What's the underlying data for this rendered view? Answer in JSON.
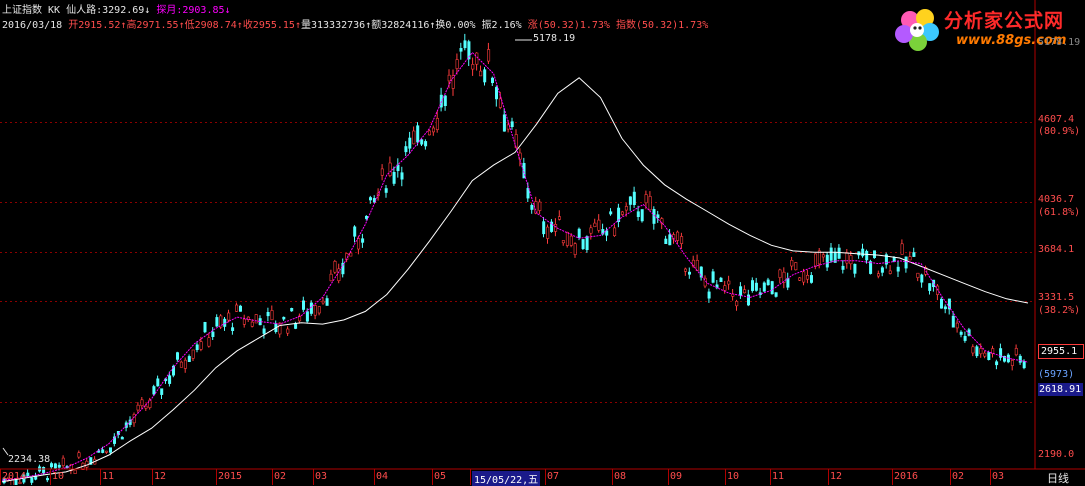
{
  "header": {
    "index_name": "上证指数",
    "indicator": "KK",
    "line1_label": "仙人路:3292.69",
    "line1_arrow": "↓",
    "line2_label": "探月:2903.85",
    "line2_arrow": "↓",
    "date": "2016/03/18",
    "open": "开2915.52",
    "high": "高2971.55",
    "low": "低2908.74",
    "close": "收2955.15",
    "volume": "量313332736",
    "amount": "额32824116",
    "turnover": "换0.00%",
    "amplitude": "振2.16%",
    "change": "涨(50.32)1.73%",
    "points": "指数(50.32)1.73%"
  },
  "logo": {
    "title": "分析家公式网",
    "url": "www.88gs.com"
  },
  "right_axis": {
    "top_partial": "5178.19",
    "l1": "4607.4",
    "l1p": "(80.9%)",
    "l2": "4036.7",
    "l2p": "(61.8%)",
    "l3": "3684.1",
    "l4": "3331.5",
    "l4p": "(38.2%)",
    "current": "2955.1",
    "count": "(5973)",
    "low_mark": "2618.91",
    "l5": "2190.0"
  },
  "annotations": {
    "high": "5178.19",
    "low": "2234.38"
  },
  "x_axis": {
    "ticks": [
      "2014",
      "10",
      "11",
      "12",
      "2015",
      "02",
      "03",
      "04",
      "05",
      "15/05/22,五",
      "07",
      "08",
      "09",
      "10",
      "11",
      "12",
      "2016",
      "02",
      "03"
    ],
    "period": "日线"
  },
  "colors": {
    "background": "#000000",
    "up": "#ff3c3c",
    "down": "#54ffff",
    "ma_long": "#ffffff",
    "ma_short": "#ff00ff",
    "grid": "#8b0000"
  },
  "chart_data": {
    "type": "candlestick",
    "ylim": [
      2190.0,
      5260.0
    ],
    "y_grid": [
      4607.4,
      4036.7,
      3684.1,
      3331.5,
      2618.91
    ],
    "series": [
      {
        "name": "仙人路",
        "values": [
          2050,
          2075,
          2100,
          2120,
          2170,
          2240,
          2340,
          2430,
          2560,
          2700,
          2860,
          2980,
          3070,
          3160,
          3180,
          3170,
          3200,
          3260,
          3380,
          3560,
          3760,
          3970,
          4190,
          4300,
          4390,
          4590,
          4810,
          4920,
          4780,
          4490,
          4300,
          4160,
          4060,
          3970,
          3880,
          3800,
          3730,
          3690,
          3680,
          3680,
          3670,
          3660,
          3640,
          3580,
          3520,
          3460,
          3400,
          3350,
          3320
        ]
      },
      {
        "name": "探月",
        "values": [
          2060,
          2080,
          2110,
          2150,
          2220,
          2320,
          2480,
          2640,
          2860,
          3030,
          3140,
          3220,
          3190,
          3170,
          3230,
          3360,
          3600,
          3880,
          4230,
          4370,
          4560,
          4900,
          5100,
          4950,
          4450,
          3960,
          3850,
          3780,
          3800,
          3930,
          4020,
          3870,
          3650,
          3460,
          3390,
          3360,
          3410,
          3520,
          3580,
          3620,
          3620,
          3600,
          3620,
          3600,
          3360,
          3140,
          2980,
          2930,
          2900
        ]
      }
    ]
  }
}
